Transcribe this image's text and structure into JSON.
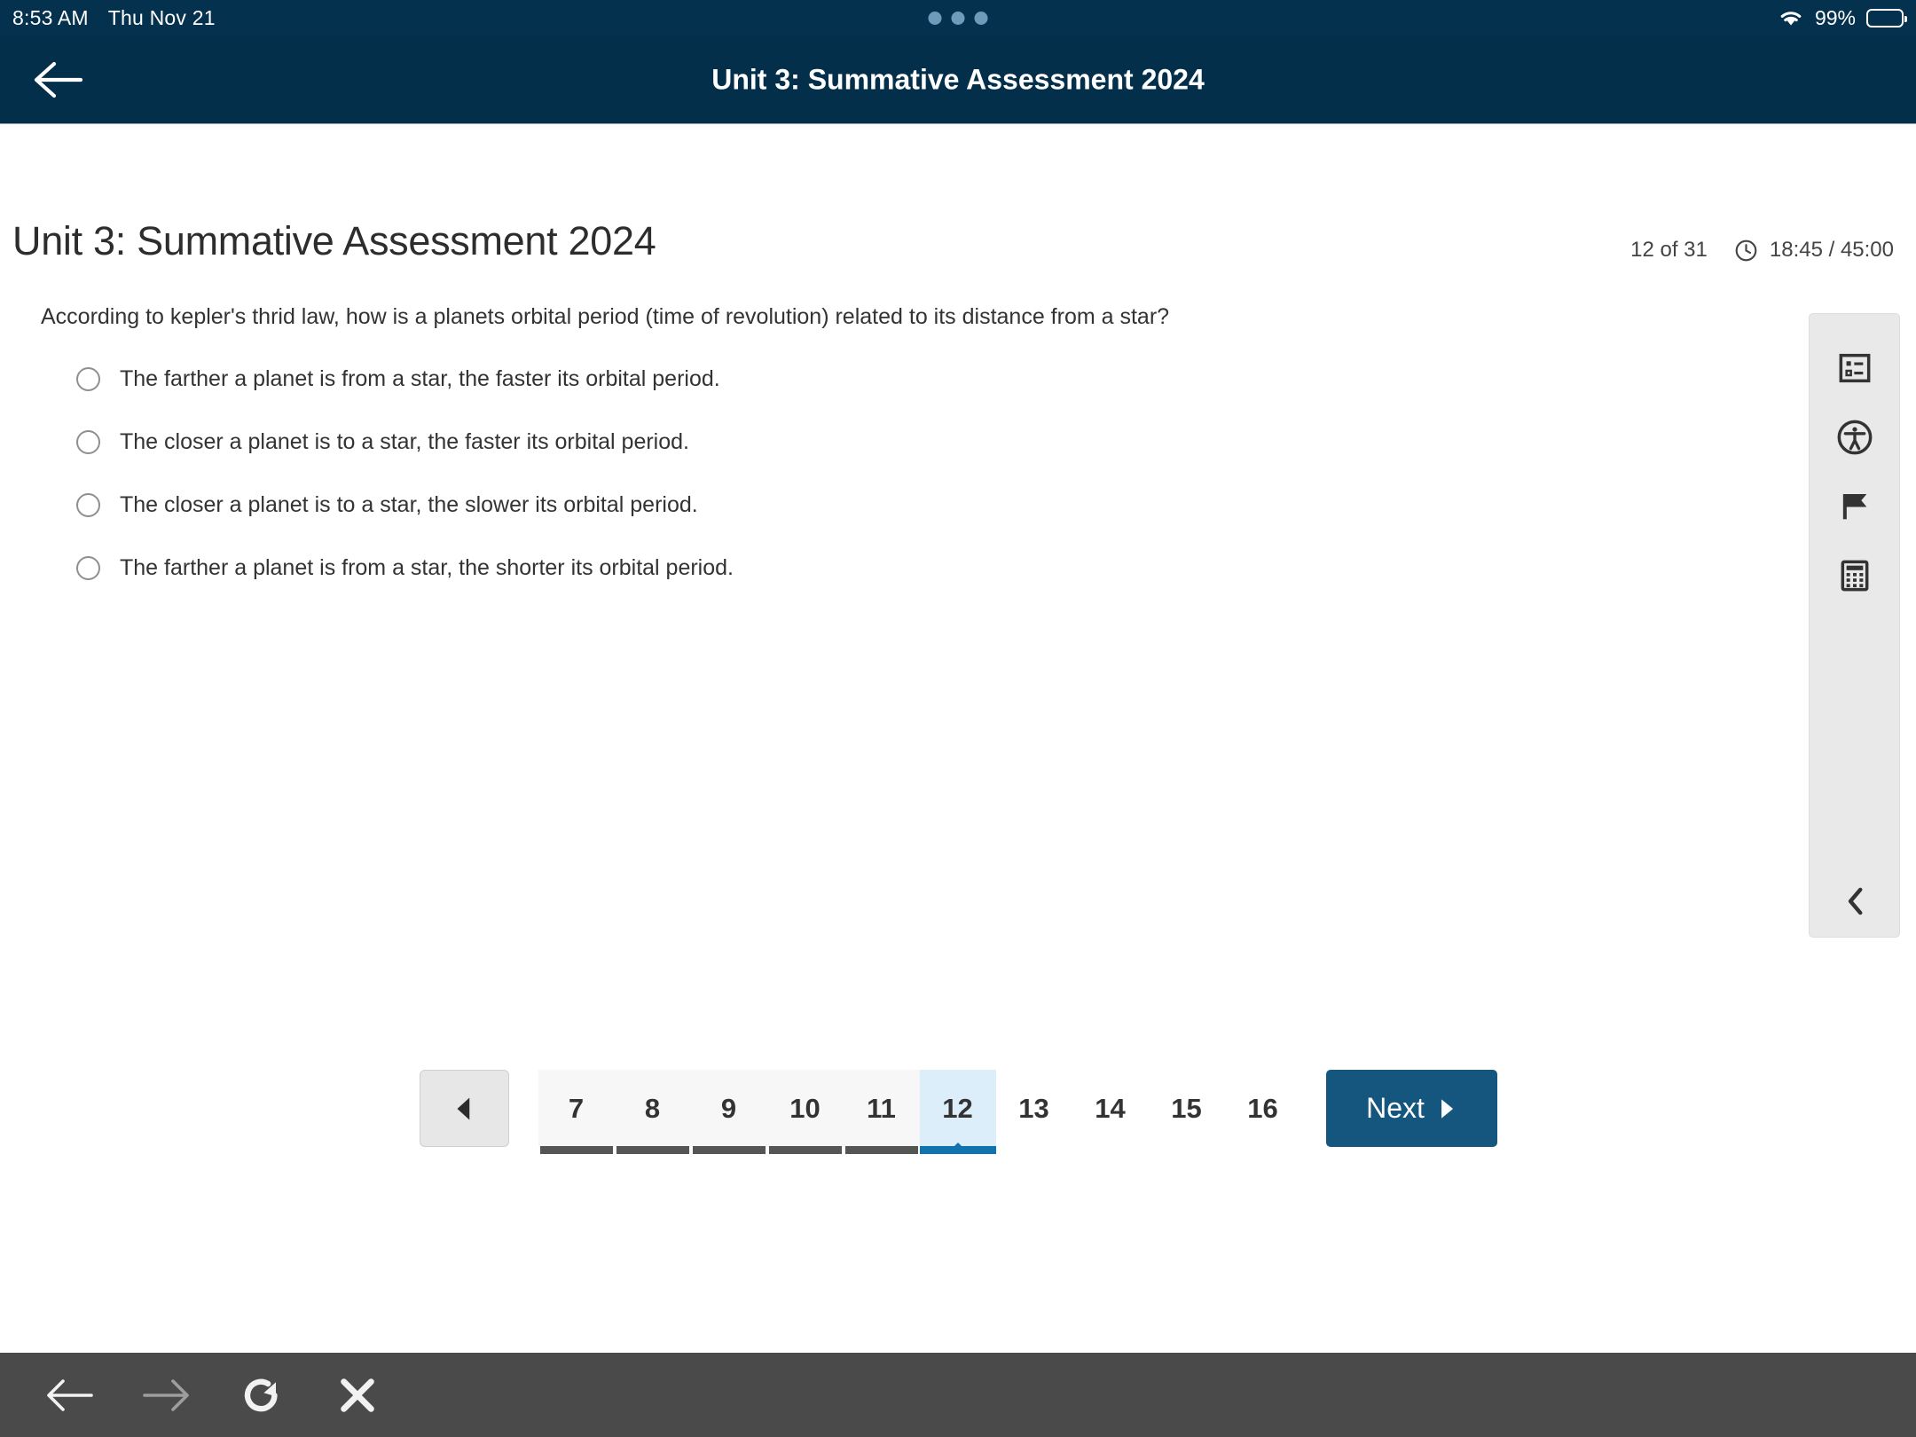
{
  "status_bar": {
    "time": "8:53 AM",
    "date": "Thu Nov 21",
    "battery_percent": "99%",
    "wifi_icon": "wifi-icon",
    "battery_icon": "battery-icon",
    "dots_icon": "three-dots-icon"
  },
  "app_bar": {
    "title": "Unit 3: Summative Assessment 2024",
    "back_icon": "back-arrow-icon",
    "background_color": "#042f4b"
  },
  "page": {
    "title": "Unit 3: Summative Assessment 2024",
    "question_counter": "12 of 31",
    "timer": "18:45 / 45:00",
    "clock_icon": "clock-icon"
  },
  "question": {
    "text": "According to kepler's thrid law, how is a planets orbital period (time of revolution) related to its distance from a star?",
    "options": [
      {
        "label": "The farther a planet is from a star, the faster its orbital period.",
        "selected": false
      },
      {
        "label": "The closer a planet is to a star, the faster its orbital period.",
        "selected": false
      },
      {
        "label": "The closer a planet is to a star, the slower its orbital period.",
        "selected": false
      },
      {
        "label": "The farther a planet is from a star, the shorter its orbital period.",
        "selected": false
      }
    ]
  },
  "tool_rail": {
    "items": [
      {
        "icon": "question-navigator-icon",
        "name": "question-navigator"
      },
      {
        "icon": "accessibility-icon",
        "name": "accessibility"
      },
      {
        "icon": "flag-icon",
        "name": "flag-question"
      },
      {
        "icon": "calculator-icon",
        "name": "calculator"
      }
    ],
    "collapse_icon": "chevron-left-icon"
  },
  "pagination": {
    "prev_icon": "triangle-left-icon",
    "pages": [
      {
        "number": "7",
        "state": "answered"
      },
      {
        "number": "8",
        "state": "answered"
      },
      {
        "number": "9",
        "state": "answered"
      },
      {
        "number": "10",
        "state": "answered"
      },
      {
        "number": "11",
        "state": "answered"
      },
      {
        "number": "12",
        "state": "current"
      },
      {
        "number": "13",
        "state": "plain"
      },
      {
        "number": "14",
        "state": "plain"
      },
      {
        "number": "15",
        "state": "plain"
      },
      {
        "number": "16",
        "state": "plain"
      }
    ],
    "next_label": "Next",
    "next_icon": "triangle-right-icon",
    "next_color": "#15567f"
  },
  "bottom_bar": {
    "items": [
      {
        "icon": "arrow-left-icon",
        "name": "browser-back",
        "enabled": true
      },
      {
        "icon": "arrow-right-icon",
        "name": "browser-forward",
        "enabled": false
      },
      {
        "icon": "reload-icon",
        "name": "browser-reload",
        "enabled": true
      },
      {
        "icon": "close-icon",
        "name": "browser-close",
        "enabled": true
      }
    ],
    "background_color": "#4a4a4a"
  }
}
